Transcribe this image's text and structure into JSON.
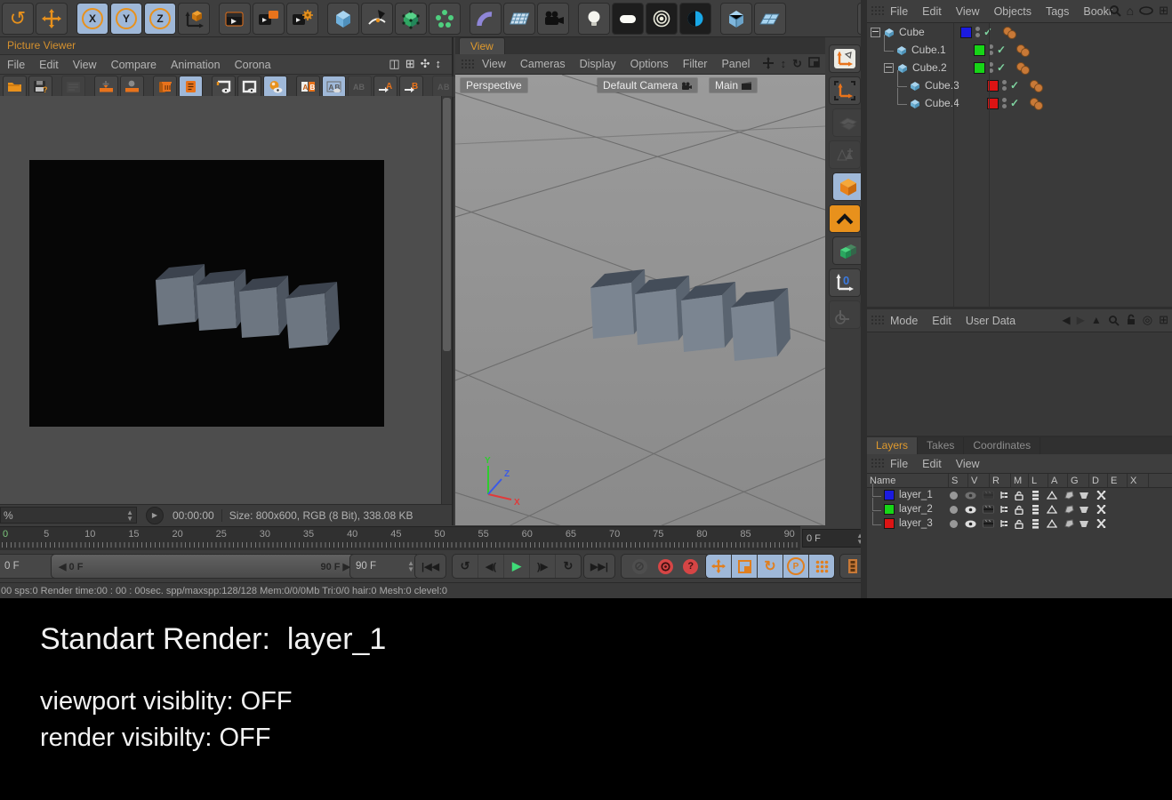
{
  "top_toolbar": {
    "icons": [
      {
        "name": "undo"
      },
      {
        "name": "move-tool"
      },
      {
        "name": "lock-x",
        "s": "active",
        "g": 1
      },
      {
        "name": "lock-y",
        "s": "active"
      },
      {
        "name": "lock-z",
        "s": "active"
      },
      {
        "name": "coordinate-system"
      },
      {
        "name": "render-view",
        "g": 1
      },
      {
        "name": "render-to-picture-viewer"
      },
      {
        "name": "render-settings"
      },
      {
        "name": "cube-primitive",
        "g": 1
      },
      {
        "name": "spline-pen"
      },
      {
        "name": "subdivision-surface"
      },
      {
        "name": "array-object"
      },
      {
        "name": "bend-deformer",
        "g": 1
      },
      {
        "name": "floor-object"
      },
      {
        "name": "camera-object"
      },
      {
        "name": "light-object",
        "g": 1
      },
      {
        "name": "area-light",
        "s": "dark"
      },
      {
        "name": "target-light",
        "s": "dark"
      },
      {
        "name": "volumetric-light",
        "s": "dark"
      },
      {
        "name": "display-cube",
        "g": 1
      },
      {
        "name": "display-plane"
      },
      {
        "name": "plugin-window",
        "g": 2
      },
      {
        "name": "google-drive"
      }
    ]
  },
  "picture_viewer": {
    "title": "Picture Viewer",
    "menus": [
      "File",
      "Edit",
      "View",
      "Compare",
      "Animation",
      "Corona"
    ],
    "toolbar_icons": [
      {
        "name": "open-file"
      },
      {
        "name": "save-image"
      },
      {
        "name": "film-settings",
        "s": "dim",
        "g": 1
      },
      {
        "name": "move-column",
        "g": 1
      },
      {
        "name": "user-column"
      },
      {
        "name": "delete-image",
        "g": 1
      },
      {
        "name": "notes",
        "s": "active"
      },
      {
        "name": "frame-a",
        "g": 1
      },
      {
        "name": "frame-b"
      },
      {
        "name": "ball-compare",
        "s": "active"
      },
      {
        "name": "ab-panels",
        "g": 1
      },
      {
        "name": "ab-split",
        "s": "active"
      },
      {
        "name": "ab-off",
        "s": "dim"
      },
      {
        "name": "set-a"
      },
      {
        "name": "set-b"
      },
      {
        "name": "ab-small-1",
        "s": "dim",
        "g": 1
      },
      {
        "name": "ab-small-2",
        "s": "dim"
      }
    ],
    "zoom_value": "%",
    "time": "00:00:00",
    "info": "Size: 800x600, RGB (8 Bit), 338.08 KB"
  },
  "viewport": {
    "tab": "View",
    "menus": [
      "View",
      "Cameras",
      "Display",
      "Options",
      "Filter",
      "Panel"
    ],
    "projection": "Perspective",
    "camera": "Default Camera",
    "take": "Main",
    "axis_labels": {
      "x": "X",
      "y": "Y",
      "z": "Z"
    }
  },
  "mode_toolbar": {
    "icons": [
      {
        "name": "make-editable"
      },
      {
        "name": "model-mode"
      },
      {
        "name": "texture-axis-mode",
        "s": "dim",
        "g": 1
      },
      {
        "name": "point-mode",
        "s": "dim"
      },
      {
        "name": "object-mode",
        "s": "active",
        "g": 1
      },
      {
        "name": "texture-mode",
        "s": "orange"
      },
      {
        "name": "workplane-mode",
        "g": 1
      },
      {
        "name": "coordinates-mode"
      },
      {
        "name": "axis-lock",
        "s": "dim"
      }
    ]
  },
  "object_manager": {
    "menus": [
      "File",
      "Edit",
      "View",
      "Objects",
      "Tags",
      "Bookr"
    ],
    "objects": [
      {
        "name": "Cube",
        "indent": 0,
        "expandable": true,
        "color": "#1b1be0"
      },
      {
        "name": "Cube.1",
        "indent": 1,
        "expandable": false,
        "color": "#17d517"
      },
      {
        "name": "Cube.2",
        "indent": 1,
        "expandable": true,
        "color": "#17d517"
      },
      {
        "name": "Cube.3",
        "indent": 2,
        "expandable": false,
        "color": "#dc1414"
      },
      {
        "name": "Cube.4",
        "indent": 2,
        "expandable": false,
        "color": "#dc1414"
      }
    ]
  },
  "attribute_manager": {
    "menus": [
      "Mode",
      "Edit",
      "User Data"
    ]
  },
  "layers_panel": {
    "tabs": [
      {
        "label": "Layers",
        "active": true
      },
      {
        "label": "Takes",
        "active": false
      },
      {
        "label": "Coordinates",
        "active": false
      }
    ],
    "menus": [
      "File",
      "Edit",
      "View"
    ],
    "columns": [
      "Name",
      "S",
      "V",
      "R",
      "M",
      "L",
      "A",
      "G",
      "D",
      "E",
      "X"
    ],
    "layers": [
      {
        "name": "layer_1",
        "color": "#1b1be0",
        "viewport_visible": false,
        "render_visible": false
      },
      {
        "name": "layer_2",
        "color": "#17d517",
        "viewport_visible": true,
        "render_visible": true
      },
      {
        "name": "layer_3",
        "color": "#dc1414",
        "viewport_visible": true,
        "render_visible": true
      }
    ]
  },
  "timeline": {
    "frames": [
      0,
      5,
      10,
      15,
      20,
      25,
      30,
      35,
      40,
      45,
      50,
      55,
      60,
      65,
      70,
      75,
      80,
      85,
      90
    ],
    "current_frame_label": "0 F",
    "start_field": "0 F",
    "range_start": "0 F",
    "range_end": "90 F",
    "end_field": "90 F"
  },
  "render_status": "00 sps:0 Render time:00 : 00 : 00sec. spp/maxspp:128/128 Mem:0/0/0Mb Tri:0/0 hair:0 Mesh:0 clevel:0",
  "caption": {
    "title": "Standart Render:  layer_1",
    "line1": "viewport visiblity: OFF",
    "line2": "render visibilty: OFF"
  },
  "colors": {
    "accent_orange": "#e8911c",
    "highlight_blue": "#9fb8d8",
    "check_green": "#7fd4a0",
    "tag_orange": "#c87937"
  }
}
